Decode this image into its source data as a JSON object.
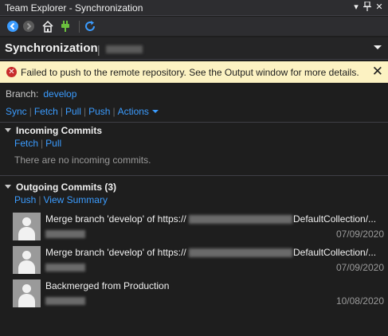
{
  "window": {
    "title": "Team Explorer - Synchronization",
    "pin_label": "▂",
    "close_label": "✕"
  },
  "toolbar": {
    "icons": [
      "back-icon",
      "forward-icon",
      "home-icon",
      "connect-icon",
      "refresh-icon"
    ]
  },
  "page": {
    "title": "Synchronization",
    "separator": "|"
  },
  "error": {
    "message": "Failed to push to the remote repository. See the Output window for more details.",
    "icon": "✕",
    "close": "✕"
  },
  "branch": {
    "label": "Branch:",
    "value": "develop"
  },
  "actions": {
    "sync": "Sync",
    "fetch": "Fetch",
    "pull": "Pull",
    "push": "Push",
    "more": "Actions"
  },
  "incoming": {
    "title": "Incoming Commits",
    "fetch": "Fetch",
    "pull": "Pull",
    "empty": "There are no incoming commits."
  },
  "outgoing": {
    "title": "Outgoing Commits (3)",
    "push": "Push",
    "view_summary": "View Summary",
    "commits": [
      {
        "message": "Merge branch 'develop' of https://",
        "message_tail": "DefaultCollection/...",
        "date": "07/09/2020"
      },
      {
        "message": "Merge branch 'develop' of https://",
        "message_tail": "DefaultCollection/...",
        "date": "07/09/2020"
      },
      {
        "message": "Backmerged from Production",
        "message_tail": "",
        "date": "10/08/2020"
      }
    ]
  },
  "colors": {
    "accent": "#3b9cff",
    "error_bg": "#fcf2c2",
    "error_icon": "#c72b2b"
  }
}
